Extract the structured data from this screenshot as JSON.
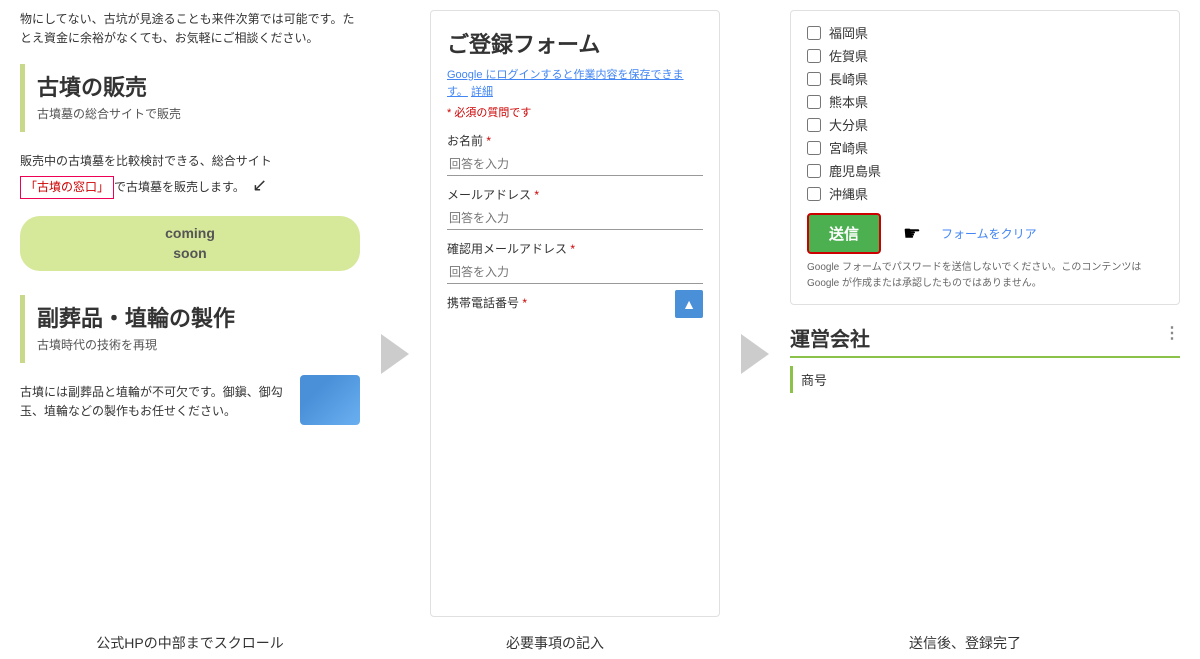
{
  "left": {
    "top_text": "物にしてない、古坑が見途ることも来件次第では可能です。たとえ資金に余裕がなくても、お気軽にご相談ください。",
    "section1": {
      "title": "古墳の販売",
      "subtitle": "古墳墓の総合サイトで販売",
      "desc1": "販売中の古墳墓を比較検討できる、総合サイト",
      "link_text": "「古墳の窓口」",
      "desc2": "で古墳墓を販売します。",
      "coming_soon": "coming\nsoon"
    },
    "section2": {
      "title": "副葬品・埴輪の製作",
      "subtitle": "古墳時代の技術を再現",
      "desc": "古墳には副葬品と埴輪が不可欠です。御鎭、御勾玉、埴輪などの製作もお任せください。"
    }
  },
  "arrows": {
    "label": "→"
  },
  "middle": {
    "form_title": "ご登録フォーム",
    "google_note": "Google にログインすると作業内容を保存できます。",
    "google_note_link": "詳細",
    "required_note": "* 必須の質問です",
    "fields": [
      {
        "label": "お名前",
        "required": true,
        "placeholder": "回答を入力"
      },
      {
        "label": "メールアドレス",
        "required": true,
        "placeholder": "回答を入力"
      },
      {
        "label": "確認用メールアドレス",
        "required": true,
        "placeholder": "回答を入力"
      },
      {
        "label": "携帯電話番号",
        "required": true,
        "placeholder": ""
      }
    ]
  },
  "right": {
    "checkboxes": [
      "福岡県",
      "佐賀県",
      "長崎県",
      "熊本県",
      "大分県",
      "宮崎県",
      "鹿児島県",
      "沖縄県"
    ],
    "submit_btn": "送信",
    "clear_form": "フォームをクリア",
    "disclaimer": "Google フォームでパスワードを送信しないでください。このコンテンツは Google が作成または承認したものではありません。",
    "company": {
      "title": "運営会社",
      "label": "商号"
    }
  },
  "bottom_labels": {
    "left": "公式HPの中部までスクロール",
    "middle": "必要事項の記入",
    "right": "送信後、登録完了"
  }
}
